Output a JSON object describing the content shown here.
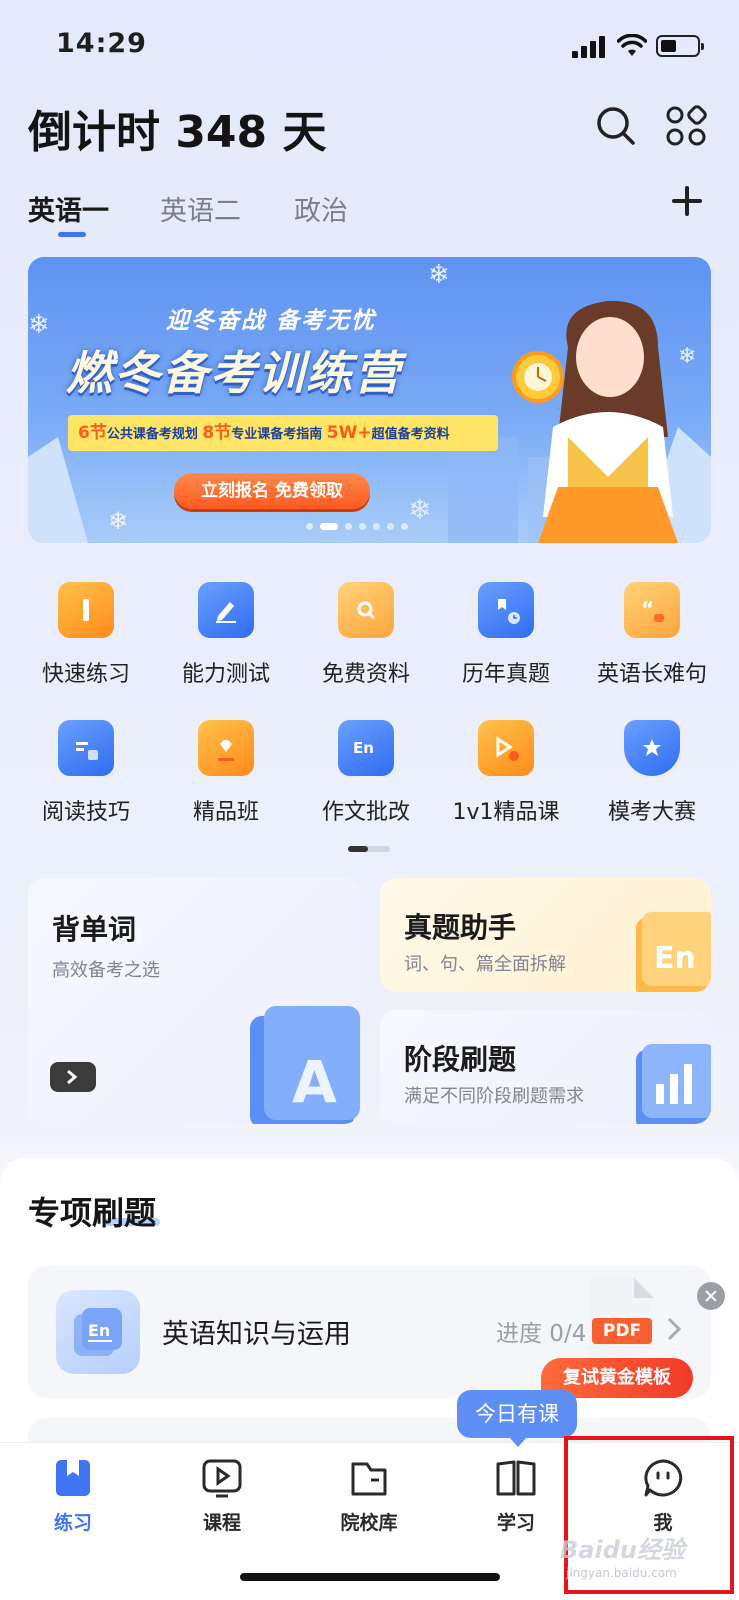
{
  "status": {
    "time": "14:29"
  },
  "header": {
    "countdown": "倒计时 348 天"
  },
  "tabs": [
    {
      "label": "英语一",
      "active": true
    },
    {
      "label": "英语二",
      "active": false
    },
    {
      "label": "政治",
      "active": false
    }
  ],
  "banner": {
    "slogan": "迎冬奋战 备考无忧",
    "title": "燃冬备考训练营",
    "strip": {
      "n1": "6节",
      "t1": "公共课备考规划",
      "n2": "8节",
      "t2": "专业课备考指南",
      "n3": "5W+",
      "t3": "超值备考资料"
    },
    "cta": "立刻报名 免费领取",
    "active_dot": 2,
    "dots": 7
  },
  "features": [
    {
      "label": "快速练习",
      "icon": "pencil-book-icon"
    },
    {
      "label": "能力测试",
      "icon": "edit-pad-icon"
    },
    {
      "label": "免费资料",
      "icon": "search-folder-icon"
    },
    {
      "label": "历年真题",
      "icon": "clock-book-icon"
    },
    {
      "label": "英语长难句",
      "icon": "quote-bubble-icon"
    },
    {
      "label": "阅读技巧",
      "icon": "open-book-icon"
    },
    {
      "label": "精品班",
      "icon": "diamond-screen-icon"
    },
    {
      "label": "作文批改",
      "icon": "en-doc-icon"
    },
    {
      "label": "1v1精品课",
      "icon": "play-tutor-icon"
    },
    {
      "label": "模考大赛",
      "icon": "trophy-icon"
    }
  ],
  "cards": {
    "vocab": {
      "title": "背单词",
      "subtitle": "高效备考之选"
    },
    "exam": {
      "title": "真题助手",
      "subtitle": "词、句、篇全面拆解"
    },
    "stage": {
      "title": "阶段刷题",
      "subtitle": "满足不同阶段刷题需求"
    }
  },
  "section": {
    "title": "专项刷题",
    "item": {
      "title": "英语知识与运用",
      "progress": "进度 0/4"
    }
  },
  "promo": {
    "pdf": "PDF",
    "label": "复试黄金模板"
  },
  "tabbar": {
    "bubble": "今日有课",
    "items": [
      {
        "label": "练习",
        "active": true
      },
      {
        "label": "课程",
        "active": false
      },
      {
        "label": "院校库",
        "active": false
      },
      {
        "label": "学习",
        "active": false
      },
      {
        "label": "我",
        "active": false
      }
    ]
  },
  "watermark": {
    "brand": "Baidu经验",
    "url": "jingyan.baidu.com"
  },
  "colors": {
    "accent": "#3f75f3",
    "cta": "#ff5a22",
    "highlight": "#e3141b"
  }
}
